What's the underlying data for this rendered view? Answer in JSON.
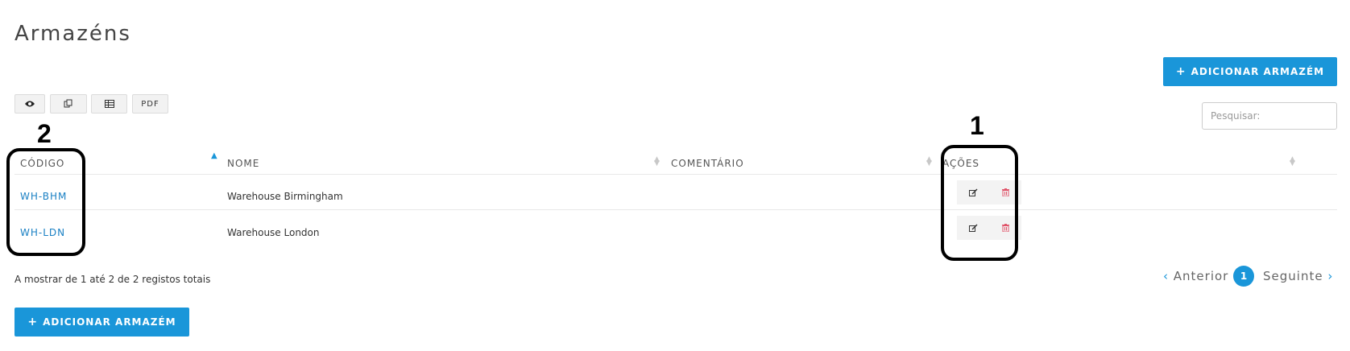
{
  "page": {
    "title": "Armazéns"
  },
  "actions": {
    "add_label": "ADICIONAR ARMAZÉM"
  },
  "toolbar": {
    "pdf_label": "PDF"
  },
  "search": {
    "placeholder": "Pesquisar:"
  },
  "table": {
    "columns": [
      "CÓDIGO",
      "NOME",
      "COMENTÁRIO",
      "AÇÕES"
    ],
    "rows": [
      {
        "code": "WH-BHM",
        "name": "Warehouse Birmingham",
        "comment": ""
      },
      {
        "code": "WH-LDN",
        "name": "Warehouse London",
        "comment": ""
      }
    ]
  },
  "info": "A mostrar de 1 até 2 de 2 registos totais",
  "pagination": {
    "prev": "Anterior",
    "next": "Seguinte",
    "current": "1"
  },
  "annotations": {
    "a1": "1",
    "a2": "2"
  },
  "colors": {
    "accent": "#1a96d9",
    "link": "#1a80c4",
    "delete": "#e0566b"
  },
  "icons": [
    "eye-icon",
    "copy-icon",
    "table-icon",
    "edit-icon",
    "trash-icon",
    "plus-icon",
    "sort-icon",
    "chevron-left-icon",
    "chevron-right-icon"
  ]
}
